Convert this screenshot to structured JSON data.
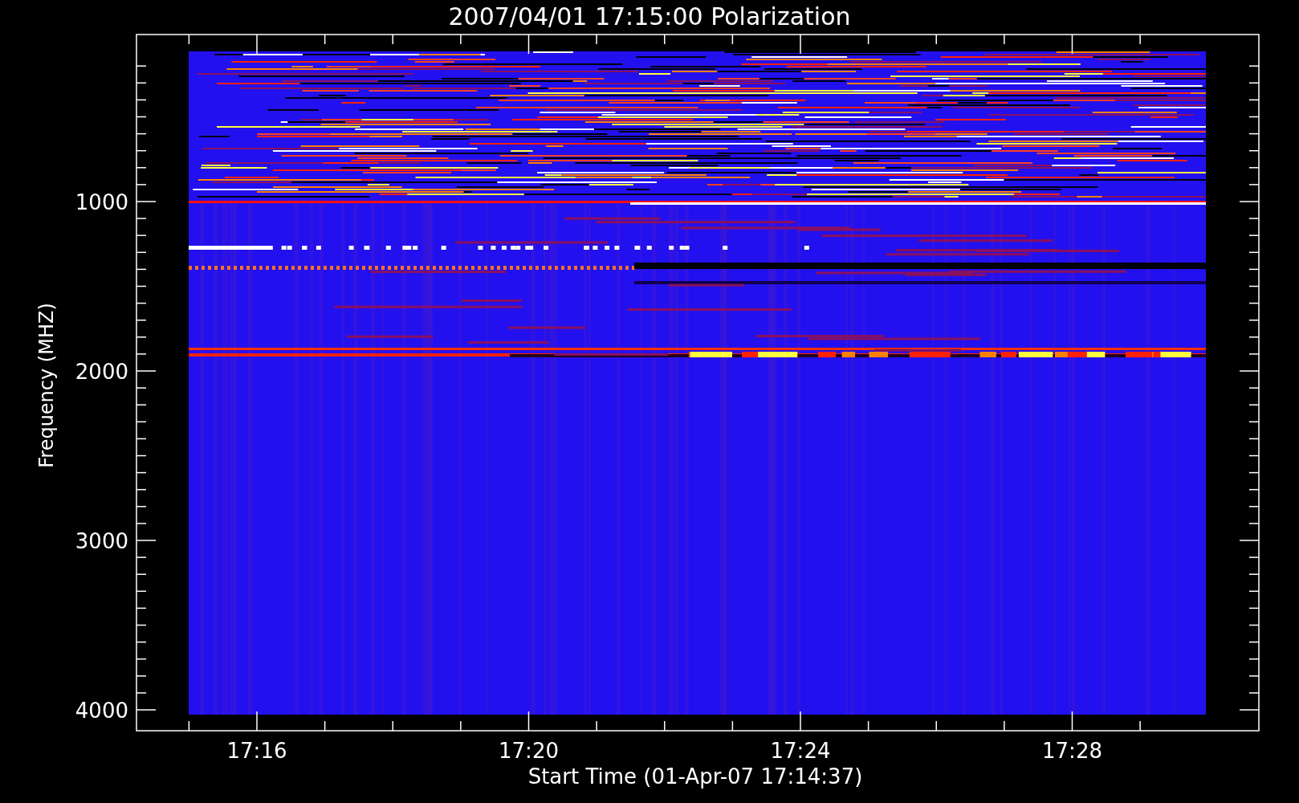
{
  "title": "2007/04/01 17:15:00 Polarization",
  "y_axis": {
    "label": "Frequency (MHZ)",
    "ticks": [
      "1000",
      "2000",
      "3000",
      "4000"
    ]
  },
  "x_axis": {
    "label": "Start Time (01-Apr-07 17:14:37)",
    "ticks": [
      "17:16",
      "17:20",
      "17:24",
      "17:28"
    ]
  }
}
